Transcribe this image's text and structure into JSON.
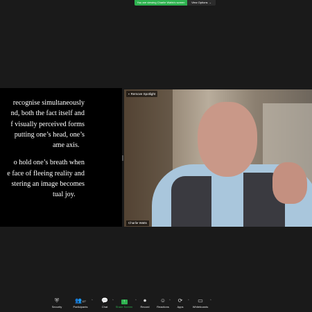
{
  "banner": {
    "text": "You are viewing Charlie Watts's screen"
  },
  "view_options": {
    "label": "View Options"
  },
  "shared_screen": {
    "paragraph1": [
      "recognise simultaneously",
      "nd, both the fact itself and",
      "f visually perceived forms",
      "putting one’s head, one’s",
      "ame axis."
    ],
    "paragraph2": [
      "o hold one’s breath when",
      "e face of fleeing reality and",
      "stering an image becomes",
      "tual joy."
    ]
  },
  "video": {
    "spotlight_label": "Remove Spotlight",
    "participant_name": "Charlie Watts"
  },
  "toolbar": {
    "security": "Security",
    "participants": "Participants",
    "participants_count": "127",
    "chat": "Chat",
    "share_screen": "Share Screen",
    "record": "Record",
    "reactions": "Reactions",
    "apps": "Apps",
    "whiteboards": "Whiteboards"
  },
  "colors": {
    "accent_green": "#2eb24f",
    "background": "#1a1a1a"
  }
}
